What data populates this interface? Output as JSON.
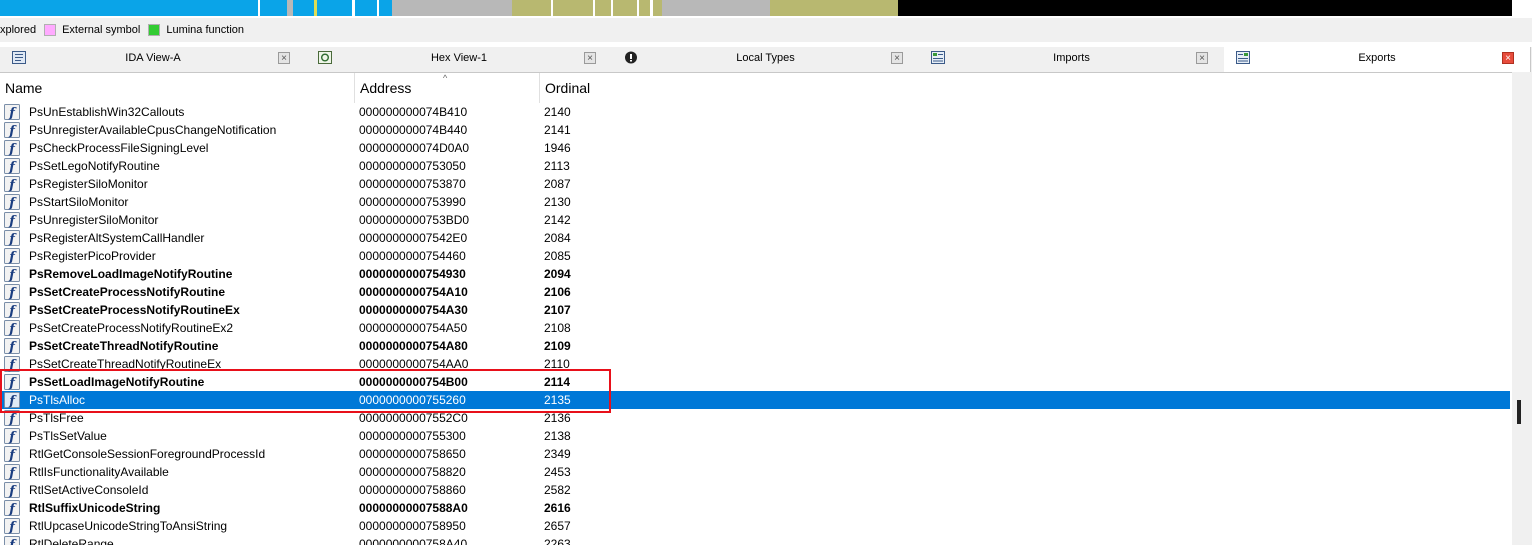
{
  "legend": {
    "items": [
      {
        "label": "xplored",
        "color": ""
      },
      {
        "label": "External symbol",
        "color": "#ffaaff"
      },
      {
        "label": "Lumina function",
        "color": "#33cc33"
      }
    ]
  },
  "tabs": [
    {
      "label": "IDA View-A",
      "icon": "ida-view-icon",
      "active": false
    },
    {
      "label": "Hex View-1",
      "icon": "hex-view-icon",
      "active": false
    },
    {
      "label": "Local Types",
      "icon": "local-types-icon",
      "active": false
    },
    {
      "label": "Imports",
      "icon": "imports-icon",
      "active": false
    },
    {
      "label": "Exports",
      "icon": "exports-icon",
      "active": true
    }
  ],
  "table": {
    "columns": [
      "Name",
      "Address",
      "Ordinal"
    ],
    "rows": [
      {
        "name": "PsUnEstablishWin32Callouts",
        "address": "000000000074B410",
        "ordinal": "2140",
        "bold": false,
        "selected": false
      },
      {
        "name": "PsUnregisterAvailableCpusChangeNotification",
        "address": "000000000074B440",
        "ordinal": "2141",
        "bold": false,
        "selected": false
      },
      {
        "name": "PsCheckProcessFileSigningLevel",
        "address": "000000000074D0A0",
        "ordinal": "1946",
        "bold": false,
        "selected": false
      },
      {
        "name": "PsSetLegoNotifyRoutine",
        "address": "0000000000753050",
        "ordinal": "2113",
        "bold": false,
        "selected": false
      },
      {
        "name": "PsRegisterSiloMonitor",
        "address": "0000000000753870",
        "ordinal": "2087",
        "bold": false,
        "selected": false
      },
      {
        "name": "PsStartSiloMonitor",
        "address": "0000000000753990",
        "ordinal": "2130",
        "bold": false,
        "selected": false
      },
      {
        "name": "PsUnregisterSiloMonitor",
        "address": "0000000000753BD0",
        "ordinal": "2142",
        "bold": false,
        "selected": false
      },
      {
        "name": "PsRegisterAltSystemCallHandler",
        "address": "00000000007542E0",
        "ordinal": "2084",
        "bold": false,
        "selected": false
      },
      {
        "name": "PsRegisterPicoProvider",
        "address": "0000000000754460",
        "ordinal": "2085",
        "bold": false,
        "selected": false
      },
      {
        "name": "PsRemoveLoadImageNotifyRoutine",
        "address": "0000000000754930",
        "ordinal": "2094",
        "bold": true,
        "selected": false
      },
      {
        "name": "PsSetCreateProcessNotifyRoutine",
        "address": "0000000000754A10",
        "ordinal": "2106",
        "bold": true,
        "selected": false
      },
      {
        "name": "PsSetCreateProcessNotifyRoutineEx",
        "address": "0000000000754A30",
        "ordinal": "2107",
        "bold": true,
        "selected": false
      },
      {
        "name": "PsSetCreateProcessNotifyRoutineEx2",
        "address": "0000000000754A50",
        "ordinal": "2108",
        "bold": false,
        "selected": false
      },
      {
        "name": "PsSetCreateThreadNotifyRoutine",
        "address": "0000000000754A80",
        "ordinal": "2109",
        "bold": true,
        "selected": false
      },
      {
        "name": "PsSetCreateThreadNotifyRoutineEx",
        "address": "0000000000754AA0",
        "ordinal": "2110",
        "bold": false,
        "selected": false
      },
      {
        "name": "PsSetLoadImageNotifyRoutine",
        "address": "0000000000754B00",
        "ordinal": "2114",
        "bold": true,
        "selected": false
      },
      {
        "name": "PsTlsAlloc",
        "address": "0000000000755260",
        "ordinal": "2135",
        "bold": false,
        "selected": true
      },
      {
        "name": "PsTlsFree",
        "address": "00000000007552C0",
        "ordinal": "2136",
        "bold": false,
        "selected": false
      },
      {
        "name": "PsTlsSetValue",
        "address": "0000000000755300",
        "ordinal": "2138",
        "bold": false,
        "selected": false
      },
      {
        "name": "RtlGetConsoleSessionForegroundProcessId",
        "address": "0000000000758650",
        "ordinal": "2349",
        "bold": false,
        "selected": false
      },
      {
        "name": "RtlIsFunctionalityAvailable",
        "address": "0000000000758820",
        "ordinal": "2453",
        "bold": false,
        "selected": false
      },
      {
        "name": "RtlSetActiveConsoleId",
        "address": "0000000000758860",
        "ordinal": "2582",
        "bold": false,
        "selected": false
      },
      {
        "name": "RtlSuffixUnicodeString",
        "address": "00000000007588A0",
        "ordinal": "2616",
        "bold": true,
        "selected": false
      },
      {
        "name": "RtlUpcaseUnicodeStringToAnsiString",
        "address": "0000000000758950",
        "ordinal": "2657",
        "bold": false,
        "selected": false
      },
      {
        "name": "RtlDeleteRange",
        "address": "0000000000758A40",
        "ordinal": "2263",
        "bold": false,
        "selected": false
      }
    ]
  },
  "colors": {
    "selection": "#0078d7",
    "highlight_box": "#e8101a",
    "nav_blue": "#0aa4e8",
    "nav_gray": "#b8b8b8",
    "nav_olive": "#b8b870"
  }
}
